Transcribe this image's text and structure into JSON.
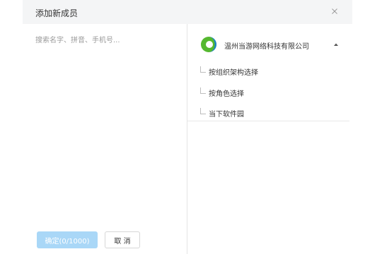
{
  "dialog": {
    "title": "添加新成员",
    "close_symbol": "×"
  },
  "search": {
    "placeholder": "搜索名字、拼音、手机号..."
  },
  "buttons": {
    "confirm_label": "确定(0/1000)",
    "cancel_label": "取 消"
  },
  "organization": {
    "name": "温州当游网络科技有限公司",
    "logo_icon": "company-logo-icon",
    "expand_icon": "caret-up-icon",
    "items": [
      {
        "label": "按组织架构选择"
      },
      {
        "label": "按角色选择"
      },
      {
        "label": "当下软件园"
      }
    ]
  },
  "colors": {
    "header_bg": "#f4f5f6",
    "confirm_bg": "#a9d7f7",
    "logo_green": "#55b82f",
    "logo_blue": "#1b83c9"
  }
}
